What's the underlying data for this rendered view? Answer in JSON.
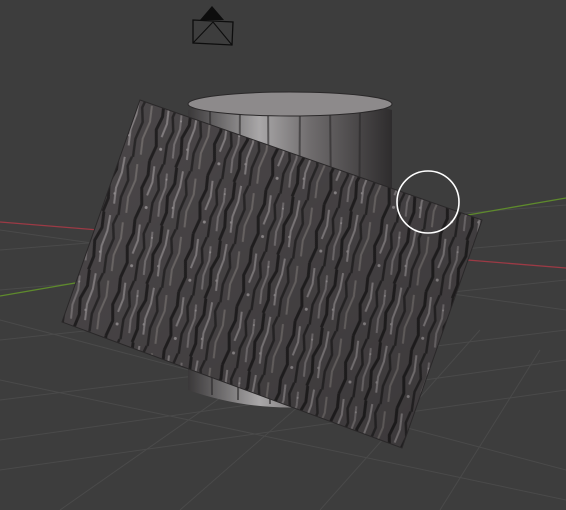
{
  "app": {
    "name": "3D Viewport"
  },
  "colors": {
    "background": "#3d3d3d",
    "grid_line": "#4a4a4a",
    "x_axis": "#9c3a45",
    "y_axis": "#5e8a2c",
    "camera_outline": "#0d0d0d",
    "brush_cursor": "#ffffff",
    "bark_dark": "#2c2a2b",
    "bark_mid": "#4f4b4d",
    "bark_light": "#8b8688",
    "cylinder_light": "#a9a7a8",
    "cylinder_dark": "#3a3839"
  },
  "scene": {
    "objects": [
      {
        "name": "camera",
        "icon": "camera-icon"
      },
      {
        "name": "cylinder",
        "material": "tree-bark"
      },
      {
        "name": "plane",
        "material": "tree-bark"
      }
    ],
    "tool_cursor": "brush-cursor-icon"
  }
}
